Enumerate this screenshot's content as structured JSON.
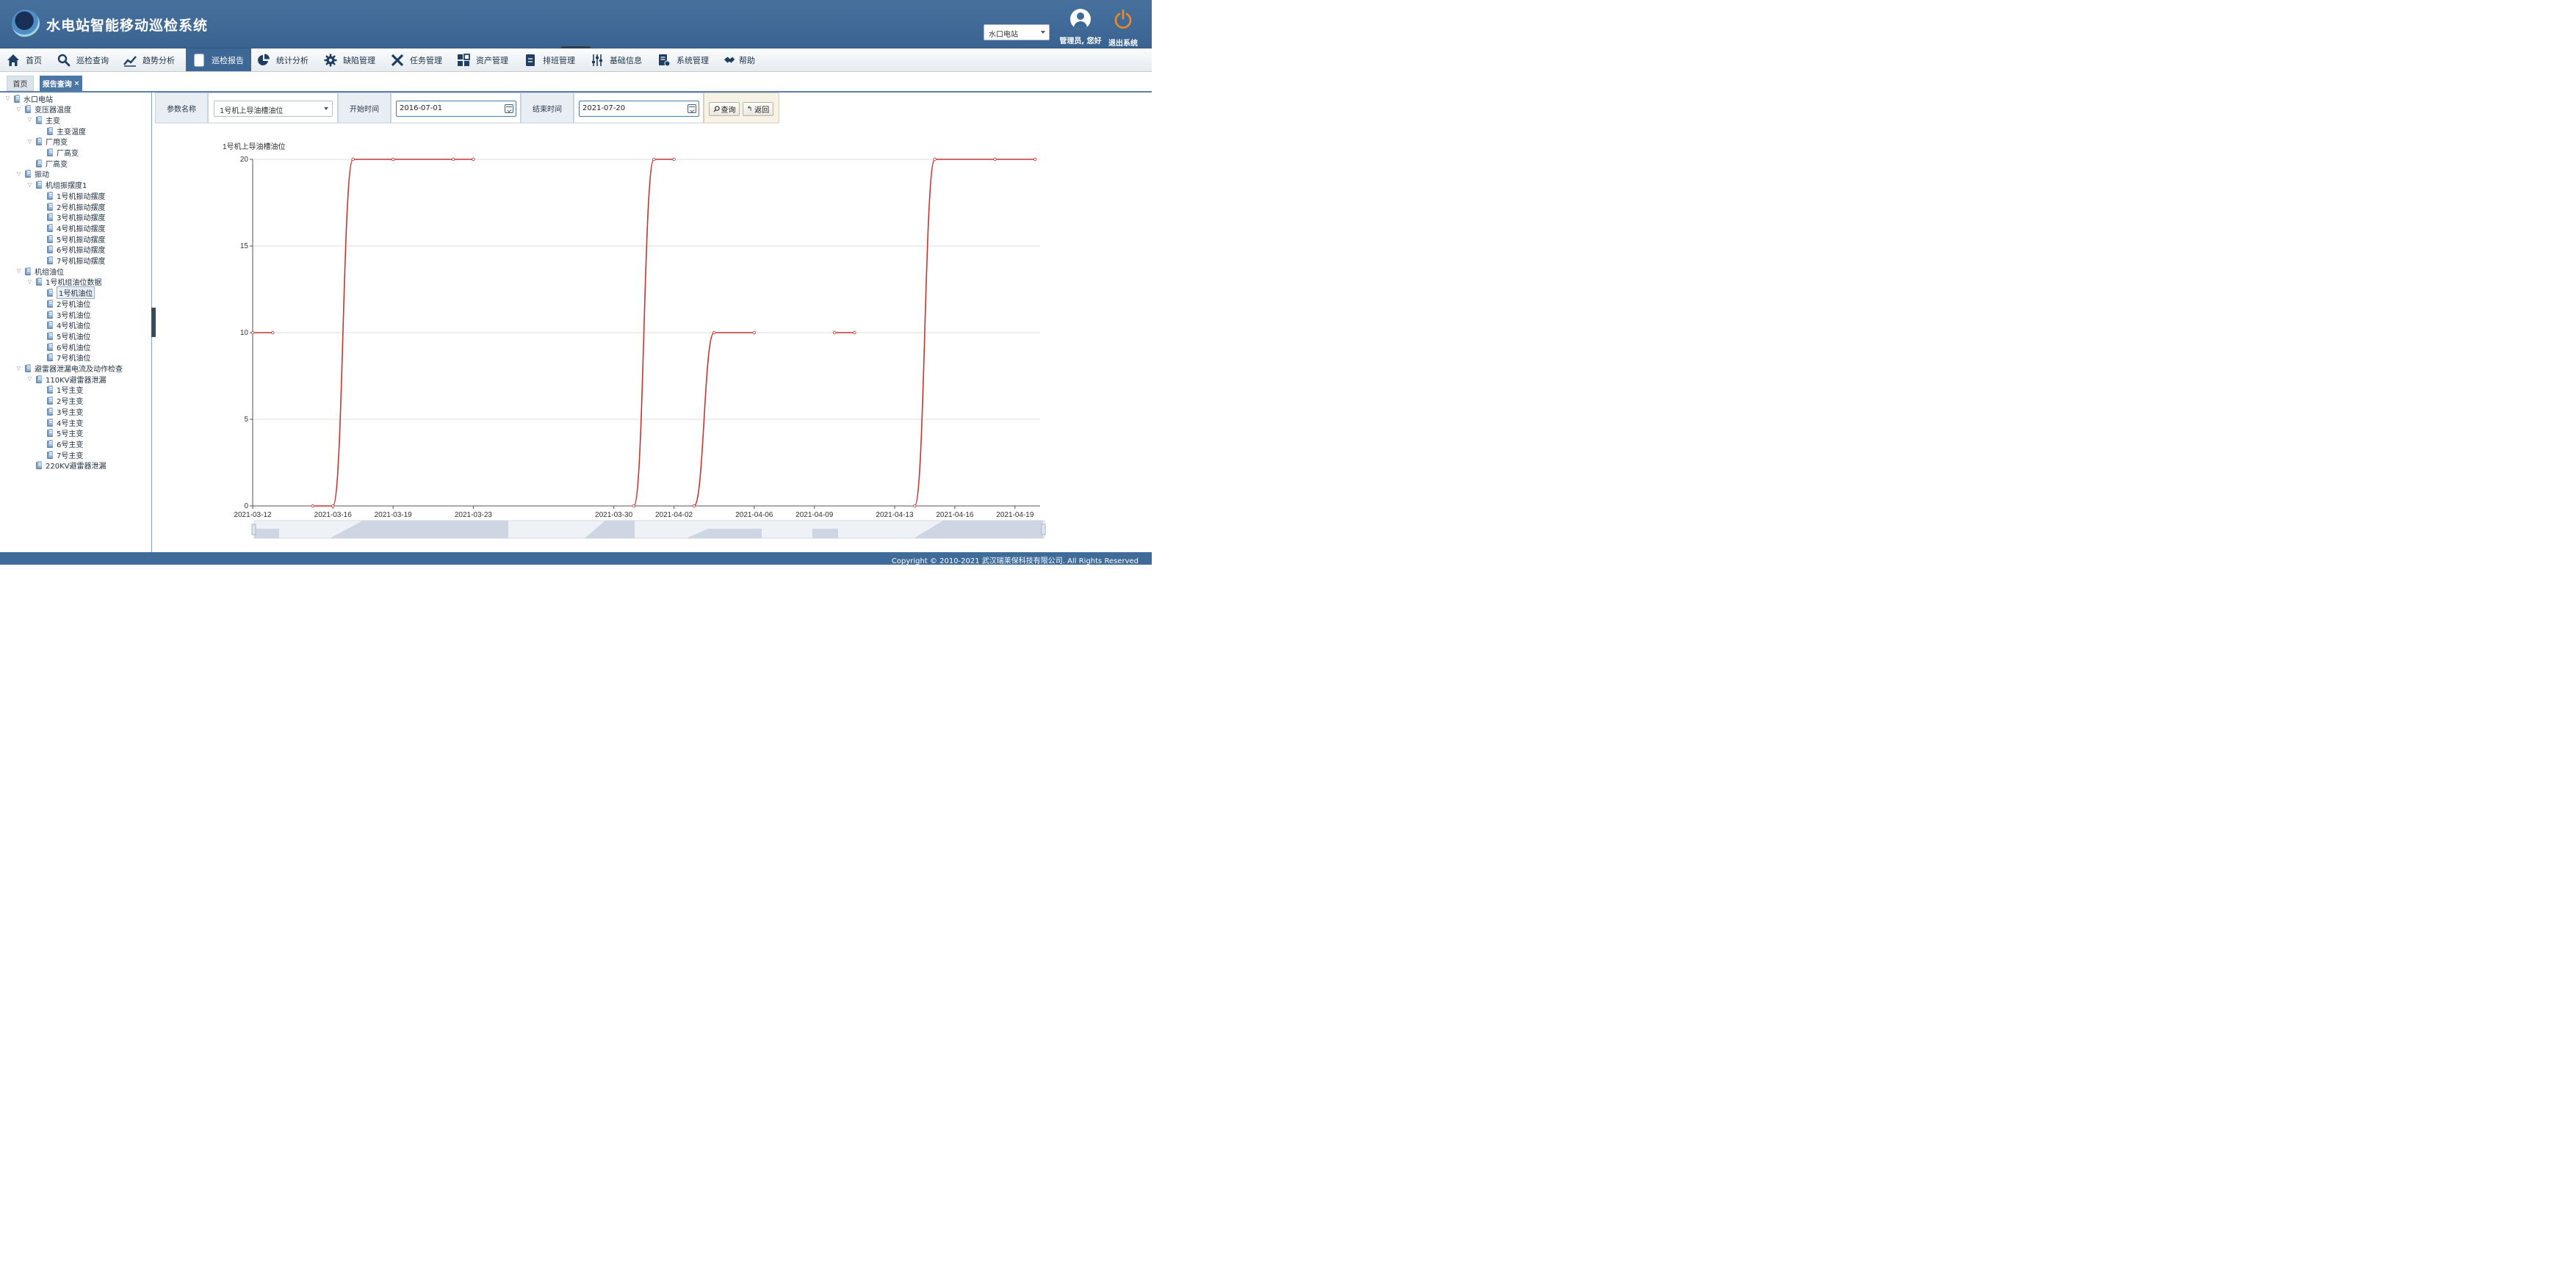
{
  "header": {
    "app_title": "水电站智能移动巡检系统",
    "station_select": "水口电站",
    "user_label": "管理员, 您好",
    "logout_label": "退出系统"
  },
  "nav": {
    "items": [
      {
        "label": "首页",
        "icon": "home-icon"
      },
      {
        "label": "巡检查询",
        "icon": "search-icon"
      },
      {
        "label": "趋势分析",
        "icon": "trend-icon"
      },
      {
        "label": "巡检报告",
        "icon": "report-icon"
      },
      {
        "label": "统计分析",
        "icon": "pie-icon"
      },
      {
        "label": "缺陷管理",
        "icon": "gear-icon"
      },
      {
        "label": "任务管理",
        "icon": "tools-icon"
      },
      {
        "label": "资产管理",
        "icon": "grid-icon"
      },
      {
        "label": "排班管理",
        "icon": "clipboard-icon"
      },
      {
        "label": "基础信息",
        "icon": "sliders-icon"
      },
      {
        "label": "系统管理",
        "icon": "settings-doc-icon"
      },
      {
        "label": "帮助",
        "icon": "handshake-icon"
      }
    ],
    "active_index": 3
  },
  "tabs": {
    "home": "首页",
    "active": "报告查询",
    "close": "×"
  },
  "tree": [
    {
      "label": "水口电站",
      "level": 0,
      "toggle": "▽"
    },
    {
      "label": "变压器温度",
      "level": 1,
      "toggle": "▽"
    },
    {
      "label": "主变",
      "level": 2,
      "toggle": "▽"
    },
    {
      "label": "主变温度",
      "level": 3,
      "toggle": ""
    },
    {
      "label": "厂用变",
      "level": 2,
      "toggle": "▽"
    },
    {
      "label": "厂高变",
      "level": 3,
      "toggle": ""
    },
    {
      "label": "厂高变",
      "level": 2,
      "toggle": ""
    },
    {
      "label": "振动",
      "level": 1,
      "toggle": "▽"
    },
    {
      "label": "机组振摆度1",
      "level": 2,
      "toggle": "▽"
    },
    {
      "label": "1号机振动摆度",
      "level": 3,
      "toggle": ""
    },
    {
      "label": "2号机振动摆度",
      "level": 3,
      "toggle": ""
    },
    {
      "label": "3号机振动摆度",
      "level": 3,
      "toggle": ""
    },
    {
      "label": "4号机振动摆度",
      "level": 3,
      "toggle": ""
    },
    {
      "label": "5号机振动摆度",
      "level": 3,
      "toggle": ""
    },
    {
      "label": "6号机振动摆度",
      "level": 3,
      "toggle": ""
    },
    {
      "label": "7号机振动摆度",
      "level": 3,
      "toggle": ""
    },
    {
      "label": "机组油位",
      "level": 1,
      "toggle": "▽"
    },
    {
      "label": "1号机组油位数据",
      "level": 2,
      "toggle": "▽"
    },
    {
      "label": "1号机油位",
      "level": 3,
      "toggle": "",
      "selected": true
    },
    {
      "label": "2号机油位",
      "level": 3,
      "toggle": ""
    },
    {
      "label": "3号机油位",
      "level": 3,
      "toggle": ""
    },
    {
      "label": "4号机油位",
      "level": 3,
      "toggle": ""
    },
    {
      "label": "5号机油位",
      "level": 3,
      "toggle": ""
    },
    {
      "label": "6号机油位",
      "level": 3,
      "toggle": ""
    },
    {
      "label": "7号机油位",
      "level": 3,
      "toggle": ""
    },
    {
      "label": "避雷器泄漏电流及动作检查",
      "level": 1,
      "toggle": "▽"
    },
    {
      "label": "110KV避雷器泄漏",
      "level": 2,
      "toggle": "▽"
    },
    {
      "label": "1号主变",
      "level": 3,
      "toggle": ""
    },
    {
      "label": "2号主变",
      "level": 3,
      "toggle": ""
    },
    {
      "label": "3号主变",
      "level": 3,
      "toggle": ""
    },
    {
      "label": "4号主变",
      "level": 3,
      "toggle": ""
    },
    {
      "label": "5号主变",
      "level": 3,
      "toggle": ""
    },
    {
      "label": "6号主变",
      "level": 3,
      "toggle": ""
    },
    {
      "label": "7号主变",
      "level": 3,
      "toggle": ""
    },
    {
      "label": "220KV避雷器泄漏",
      "level": 2,
      "toggle": ""
    }
  ],
  "filter": {
    "param_label": "参数名称",
    "param_value": "1号机上导油槽油位",
    "start_label": "开始时间",
    "start_value": "2016-07-01",
    "end_label": "结束时间",
    "end_value": "2021-07-20",
    "query_label": "查询",
    "back_label": "返回"
  },
  "chart_data": {
    "type": "line",
    "ylabel": "1号机上导油槽油位",
    "ylim": [
      0,
      20
    ],
    "yticks": [
      "0",
      "5",
      "10",
      "15",
      "20"
    ],
    "xlim": [
      "2021-03-12",
      "2021-04-21"
    ],
    "xticks": [
      "2021-03-12",
      "2021-03-16",
      "2021-03-19",
      "2021-03-23",
      "2021-03-30",
      "2021-04-02",
      "2021-04-06",
      "2021-04-09",
      "2021-04-13",
      "2021-04-16",
      "2021-04-19"
    ],
    "line_color": "#c23531",
    "series": [
      {
        "segments": [
          [
            [
              "2021-03-12",
              10
            ],
            [
              "2021-03-13",
              10
            ]
          ],
          [
            [
              "2021-03-15",
              0
            ],
            [
              "2021-03-16",
              0
            ],
            [
              "2021-03-17",
              20
            ],
            [
              "2021-03-19",
              20
            ],
            [
              "2021-03-22",
              20
            ],
            [
              "2021-03-23",
              20
            ]
          ],
          [
            [
              "2021-03-31",
              0
            ],
            [
              "2021-04-01",
              20
            ],
            [
              "2021-04-02",
              20
            ]
          ],
          [
            [
              "2021-04-03",
              0
            ],
            [
              "2021-04-04",
              10
            ],
            [
              "2021-04-06",
              10
            ]
          ],
          [
            [
              "2021-04-10",
              10
            ],
            [
              "2021-04-11",
              10
            ]
          ],
          [
            [
              "2021-04-14",
              0
            ],
            [
              "2021-04-15",
              20
            ],
            [
              "2021-04-18",
              20
            ],
            [
              "2021-04-20",
              20
            ]
          ]
        ]
      }
    ],
    "grid": true,
    "datazoom": true
  },
  "footer": {
    "copyright": "Copyright © 2010-2021 武汉瑞莱保科技有限公司. All Rights Reserved"
  }
}
